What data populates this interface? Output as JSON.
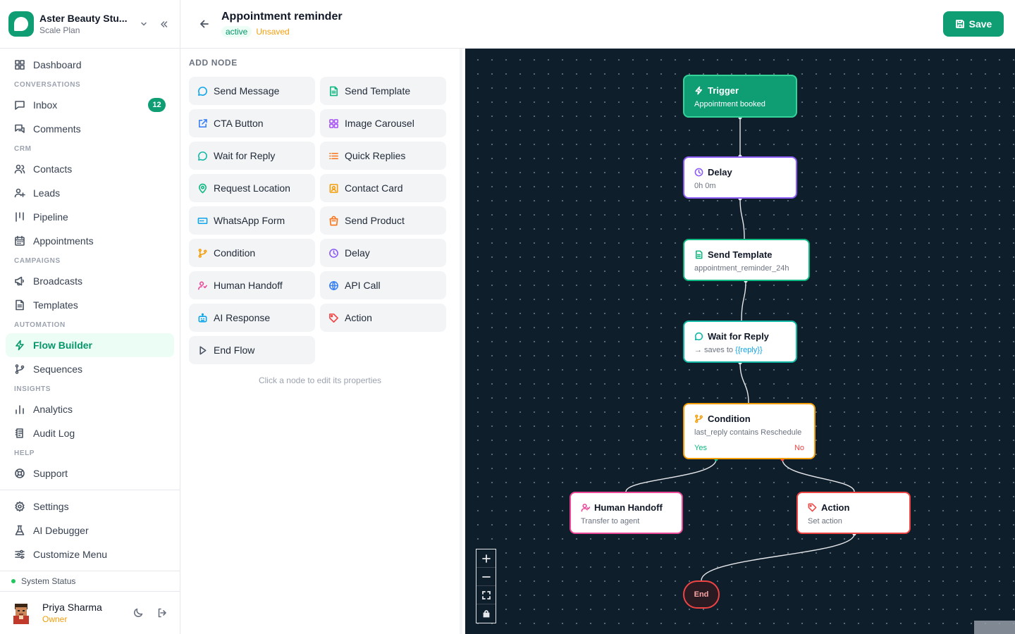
{
  "workspace": {
    "name": "Aster Beauty Stu...",
    "plan": "Scale Plan"
  },
  "sidebar": {
    "items": [
      {
        "type": "item",
        "label": "Dashboard",
        "icon": "dashboard-icon"
      },
      {
        "type": "section",
        "label": "CONVERSATIONS"
      },
      {
        "type": "item",
        "label": "Inbox",
        "icon": "inbox-icon",
        "badge": "12"
      },
      {
        "type": "item",
        "label": "Comments",
        "icon": "comments-icon"
      },
      {
        "type": "section",
        "label": "CRM"
      },
      {
        "type": "item",
        "label": "Contacts",
        "icon": "contacts-icon"
      },
      {
        "type": "item",
        "label": "Leads",
        "icon": "leads-icon"
      },
      {
        "type": "item",
        "label": "Pipeline",
        "icon": "pipeline-icon"
      },
      {
        "type": "item",
        "label": "Appointments",
        "icon": "calendar-icon"
      },
      {
        "type": "section",
        "label": "CAMPAIGNS"
      },
      {
        "type": "item",
        "label": "Broadcasts",
        "icon": "megaphone-icon"
      },
      {
        "type": "item",
        "label": "Templates",
        "icon": "template-icon"
      },
      {
        "type": "section",
        "label": "AUTOMATION"
      },
      {
        "type": "item",
        "label": "Flow Builder",
        "icon": "zap-icon",
        "active": true
      },
      {
        "type": "item",
        "label": "Sequences",
        "icon": "sequence-icon"
      },
      {
        "type": "section",
        "label": "INSIGHTS"
      },
      {
        "type": "item",
        "label": "Analytics",
        "icon": "analytics-icon"
      },
      {
        "type": "item",
        "label": "Audit Log",
        "icon": "audit-icon"
      },
      {
        "type": "section",
        "label": "HELP"
      },
      {
        "type": "item",
        "label": "Support",
        "icon": "support-icon"
      },
      {
        "type": "sep"
      },
      {
        "type": "item",
        "label": "Settings",
        "icon": "gear-icon"
      },
      {
        "type": "item",
        "label": "AI Debugger",
        "icon": "flask-icon"
      },
      {
        "type": "item",
        "label": "Customize Menu",
        "icon": "sliders-icon"
      }
    ],
    "system_status": "System Status",
    "user": {
      "name": "Priya Sharma",
      "role": "Owner"
    }
  },
  "header": {
    "title": "Appointment reminder",
    "status": "active",
    "save_state": "Unsaved",
    "save_label": "Save"
  },
  "palette": {
    "heading": "ADD NODE",
    "hint": "Click a node to edit its properties",
    "nodes": [
      {
        "label": "Send Message",
        "icon": "message-icon",
        "color": "#0ea5e9"
      },
      {
        "label": "Send Template",
        "icon": "template-icon",
        "color": "#10b981"
      },
      {
        "label": "CTA Button",
        "icon": "external-link-icon",
        "color": "#3b82f6"
      },
      {
        "label": "Image Carousel",
        "icon": "grid-icon",
        "color": "#a855f7"
      },
      {
        "label": "Wait for Reply",
        "icon": "message-icon",
        "color": "#14b8a6"
      },
      {
        "label": "Quick Replies",
        "icon": "list-icon",
        "color": "#f97316"
      },
      {
        "label": "Request Location",
        "icon": "map-pin-icon",
        "color": "#10b981"
      },
      {
        "label": "Contact Card",
        "icon": "contact-card-icon",
        "color": "#f59e0b"
      },
      {
        "label": "WhatsApp Form",
        "icon": "form-icon",
        "color": "#0ea5e9"
      },
      {
        "label": "Send Product",
        "icon": "bag-icon",
        "color": "#f97316"
      },
      {
        "label": "Condition",
        "icon": "branch-icon",
        "color": "#f59e0b"
      },
      {
        "label": "Delay",
        "icon": "clock-icon",
        "color": "#8b5cf6"
      },
      {
        "label": "Human Handoff",
        "icon": "user-icon",
        "color": "#ec4899"
      },
      {
        "label": "API Call",
        "icon": "globe-icon",
        "color": "#3b82f6"
      },
      {
        "label": "AI Response",
        "icon": "bot-icon",
        "color": "#0ea5e9"
      },
      {
        "label": "Action",
        "icon": "tag-icon",
        "color": "#ef4444"
      },
      {
        "label": "End Flow",
        "icon": "play-icon",
        "color": "#4b5563"
      }
    ]
  },
  "flow": {
    "trigger": {
      "title": "Trigger",
      "subtitle": "Appointment booked"
    },
    "delay": {
      "title": "Delay",
      "subtitle": "0h 0m"
    },
    "template": {
      "title": "Send Template",
      "subtitle": "appointment_reminder_24h"
    },
    "wait": {
      "title": "Wait for Reply",
      "subtitle_prefix": "→ saves to ",
      "variable": "{{reply}}"
    },
    "condition": {
      "title": "Condition",
      "subtitle": "last_reply contains Reschedule",
      "yes": "Yes",
      "no": "No"
    },
    "handoff": {
      "title": "Human Handoff",
      "subtitle": "Transfer to agent"
    },
    "action": {
      "title": "Action",
      "subtitle": "Set action"
    },
    "end": {
      "label": "End"
    }
  },
  "colors": {
    "brand": "#0f9d73",
    "canvas": "#0f1e2b",
    "edge": "#e5e7eb"
  }
}
